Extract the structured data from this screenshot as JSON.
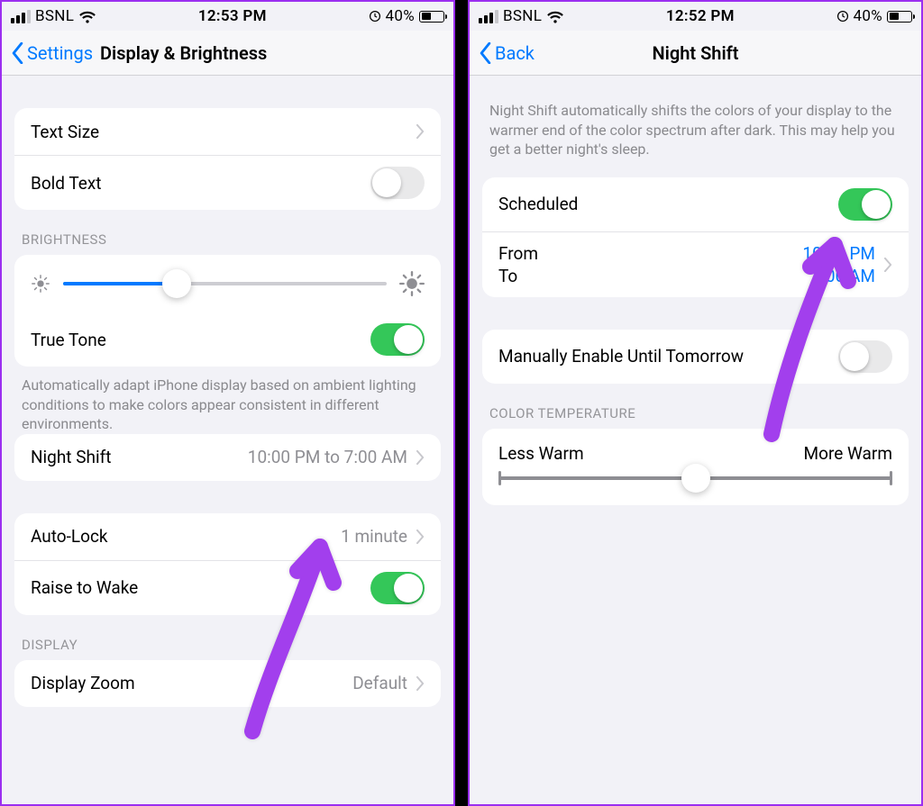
{
  "left": {
    "status": {
      "carrier": "BSNL",
      "time": "12:53 PM",
      "battery_pct": "40%"
    },
    "nav": {
      "back_label": "Settings",
      "title": "Display & Brightness"
    },
    "rows": {
      "text_size": "Text Size",
      "bold_text": "Bold Text",
      "true_tone": "True Tone",
      "night_shift": "Night Shift",
      "night_shift_value": "10:00 PM to 7:00 AM",
      "auto_lock": "Auto-Lock",
      "auto_lock_value": "1 minute",
      "raise_to_wake": "Raise to Wake",
      "display_zoom": "Display Zoom",
      "display_zoom_value": "Default"
    },
    "headers": {
      "brightness": "BRIGHTNESS",
      "display": "DISPLAY"
    },
    "footers": {
      "true_tone": "Automatically adapt iPhone display based on ambient lighting conditions to make colors appear consistent in different environments."
    },
    "brightness_slider_pct": 35,
    "switches": {
      "bold_text": false,
      "true_tone": true,
      "raise_to_wake": true
    }
  },
  "right": {
    "status": {
      "carrier": "BSNL",
      "time": "12:52 PM",
      "battery_pct": "40%"
    },
    "nav": {
      "back_label": "Back",
      "title": "Night Shift"
    },
    "intro": "Night Shift automatically shifts the colors of your display to the warmer end of the color spectrum after dark. This may help you get a better night's sleep.",
    "rows": {
      "scheduled": "Scheduled",
      "from_label": "From",
      "from_value": "10:00 PM",
      "to_label": "To",
      "to_value": "7:00 AM",
      "manual": "Manually Enable Until Tomorrow"
    },
    "headers": {
      "color_temp": "COLOR TEMPERATURE"
    },
    "temp_labels": {
      "less": "Less Warm",
      "more": "More Warm"
    },
    "temp_slider_pct": 50,
    "switches": {
      "scheduled": true,
      "manual": false
    }
  }
}
